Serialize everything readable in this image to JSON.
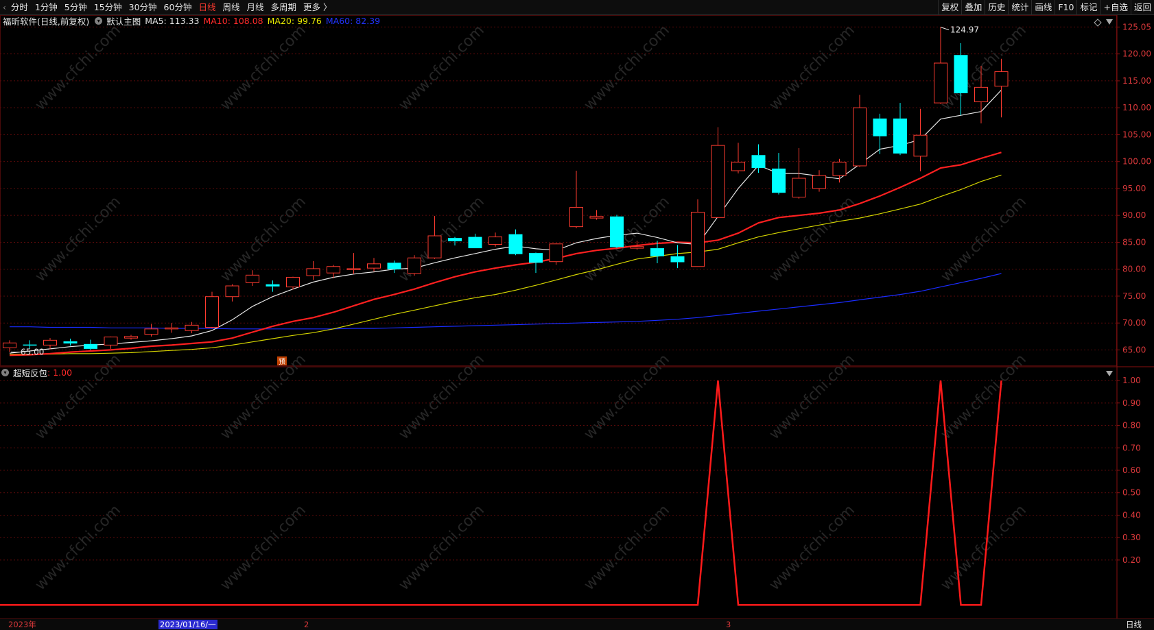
{
  "toolbar": {
    "left_items": [
      {
        "label": "分时",
        "active": false
      },
      {
        "label": "1分钟",
        "active": false
      },
      {
        "label": "5分钟",
        "active": false
      },
      {
        "label": "15分钟",
        "active": false
      },
      {
        "label": "30分钟",
        "active": false
      },
      {
        "label": "60分钟",
        "active": false
      },
      {
        "label": "日线",
        "active": true
      },
      {
        "label": "周线",
        "active": false
      },
      {
        "label": "月线",
        "active": false
      },
      {
        "label": "多周期",
        "active": false
      },
      {
        "label": "更多 〉",
        "active": false
      }
    ],
    "right_items": [
      "复权",
      "叠加",
      "历史",
      "统计",
      "画线",
      "F10",
      "标记",
      "+自选",
      "返回"
    ]
  },
  "main_legend": {
    "stock": "福昕软件(日线,前复权)",
    "main_label": "默认主图",
    "ma5": "MA5: 113.33",
    "ma10": "MA10: 108.08",
    "ma20": "MA20: 99.76",
    "ma60": "MA60: 82.39"
  },
  "sub_legend": {
    "name": "超短反包",
    "value": ": 1.00"
  },
  "colors": {
    "up": "#ff3b30",
    "down": "#00ffff",
    "ma5": "#e6e6e6",
    "ma10": "#ff2020",
    "ma20": "#d4d400",
    "ma60": "#1a2cff",
    "axis": "#d8383a",
    "grid": "#5a0a0a"
  },
  "chart_data": [
    {
      "type": "candlestick",
      "title": "福昕软件(日线,前复权)",
      "yticks": [
        65,
        70,
        75,
        80,
        85,
        90,
        95,
        100,
        105,
        110,
        115,
        120,
        125
      ],
      "ytick_labels": [
        "65.00",
        "70.00",
        "75.00",
        "80.00",
        "85.00",
        "90.00",
        "95.00",
        "100.00",
        "105.00",
        "110.00",
        "115.00",
        "120.00",
        "125.05"
      ],
      "ylim": [
        62.0,
        126.2
      ],
      "annotations": {
        "max_label": "124.97",
        "min_label": "65.00",
        "pre_marker": "预"
      },
      "candles": [
        {
          "o": 65.4,
          "h": 66.8,
          "l": 64.6,
          "c": 66.3
        },
        {
          "o": 66.0,
          "h": 66.8,
          "l": 65.2,
          "c": 65.9
        },
        {
          "o": 65.9,
          "h": 67.2,
          "l": 65.1,
          "c": 66.8
        },
        {
          "o": 66.6,
          "h": 67.1,
          "l": 65.8,
          "c": 66.2
        },
        {
          "o": 66.1,
          "h": 66.9,
          "l": 65.0,
          "c": 65.2
        },
        {
          "o": 65.9,
          "h": 67.5,
          "l": 65.2,
          "c": 67.4
        },
        {
          "o": 67.2,
          "h": 67.8,
          "l": 66.9,
          "c": 67.5
        },
        {
          "o": 67.9,
          "h": 69.8,
          "l": 67.5,
          "c": 68.9
        },
        {
          "o": 68.9,
          "h": 70.0,
          "l": 68.2,
          "c": 69.1
        },
        {
          "o": 68.6,
          "h": 70.2,
          "l": 68.1,
          "c": 69.6
        },
        {
          "o": 69.2,
          "h": 75.8,
          "l": 69.0,
          "c": 74.9
        },
        {
          "o": 74.9,
          "h": 77.2,
          "l": 74.0,
          "c": 76.9
        },
        {
          "o": 77.5,
          "h": 79.8,
          "l": 76.9,
          "c": 78.9
        },
        {
          "o": 77.2,
          "h": 77.9,
          "l": 75.8,
          "c": 76.8
        },
        {
          "o": 76.7,
          "h": 78.6,
          "l": 76.2,
          "c": 78.5
        },
        {
          "o": 78.8,
          "h": 81.5,
          "l": 78.0,
          "c": 80.1
        },
        {
          "o": 79.3,
          "h": 80.8,
          "l": 78.3,
          "c": 80.5
        },
        {
          "o": 80.1,
          "h": 83.0,
          "l": 79.1,
          "c": 80.1
        },
        {
          "o": 80.2,
          "h": 82.1,
          "l": 79.6,
          "c": 81.0
        },
        {
          "o": 81.2,
          "h": 81.6,
          "l": 79.3,
          "c": 80.0
        },
        {
          "o": 79.2,
          "h": 82.6,
          "l": 78.8,
          "c": 82.1
        },
        {
          "o": 82.1,
          "h": 89.9,
          "l": 81.9,
          "c": 86.2
        },
        {
          "o": 85.8,
          "h": 86.0,
          "l": 84.4,
          "c": 85.2
        },
        {
          "o": 86.0,
          "h": 86.6,
          "l": 83.9,
          "c": 83.9
        },
        {
          "o": 84.6,
          "h": 86.8,
          "l": 84.2,
          "c": 86.0
        },
        {
          "o": 86.5,
          "h": 87.4,
          "l": 82.6,
          "c": 82.8
        },
        {
          "o": 83.0,
          "h": 83.1,
          "l": 79.3,
          "c": 81.2
        },
        {
          "o": 81.4,
          "h": 84.8,
          "l": 80.8,
          "c": 84.7
        },
        {
          "o": 87.9,
          "h": 98.3,
          "l": 87.6,
          "c": 91.5
        },
        {
          "o": 89.5,
          "h": 91.0,
          "l": 89.2,
          "c": 89.8
        },
        {
          "o": 89.8,
          "h": 90.1,
          "l": 83.9,
          "c": 84.1
        },
        {
          "o": 83.9,
          "h": 85.3,
          "l": 83.6,
          "c": 84.2
        },
        {
          "o": 83.9,
          "h": 85.3,
          "l": 81.1,
          "c": 82.4
        },
        {
          "o": 82.4,
          "h": 84.5,
          "l": 80.2,
          "c": 81.3
        },
        {
          "o": 80.5,
          "h": 93.0,
          "l": 80.5,
          "c": 90.6
        },
        {
          "o": 89.6,
          "h": 106.4,
          "l": 89.6,
          "c": 103.0
        },
        {
          "o": 98.3,
          "h": 103.5,
          "l": 97.8,
          "c": 99.9
        },
        {
          "o": 101.2,
          "h": 103.2,
          "l": 97.9,
          "c": 98.8
        },
        {
          "o": 98.7,
          "h": 101.6,
          "l": 93.9,
          "c": 94.2
        },
        {
          "o": 93.4,
          "h": 102.5,
          "l": 93.1,
          "c": 96.9
        },
        {
          "o": 95.0,
          "h": 98.4,
          "l": 94.4,
          "c": 97.4
        },
        {
          "o": 97.4,
          "h": 100.5,
          "l": 96.1,
          "c": 99.9
        },
        {
          "o": 99.2,
          "h": 112.4,
          "l": 99.0,
          "c": 110.0
        },
        {
          "o": 108.0,
          "h": 108.9,
          "l": 101.4,
          "c": 104.7
        },
        {
          "o": 108.0,
          "h": 110.9,
          "l": 101.2,
          "c": 101.5
        },
        {
          "o": 101.0,
          "h": 109.8,
          "l": 98.2,
          "c": 104.9
        },
        {
          "o": 110.9,
          "h": 124.97,
          "l": 110.7,
          "c": 118.3
        },
        {
          "o": 119.8,
          "h": 122.0,
          "l": 108.6,
          "c": 112.7
        },
        {
          "o": 111.1,
          "h": 117.8,
          "l": 107.1,
          "c": 113.8
        },
        {
          "o": 114.0,
          "h": 119.1,
          "l": 108.2,
          "c": 116.7
        }
      ],
      "ma5": [
        64.4,
        64.8,
        65.2,
        65.6,
        65.9,
        66.1,
        66.4,
        66.7,
        67.1,
        67.6,
        68.6,
        70.6,
        73.1,
        74.9,
        76.3,
        77.6,
        78.5,
        79.1,
        79.5,
        80.0,
        80.2,
        81.2,
        82.1,
        82.9,
        83.7,
        84.3,
        83.8,
        83.5,
        84.9,
        85.7,
        86.3,
        86.7,
        85.9,
        84.9,
        84.6,
        89.8,
        95.0,
        99.3,
        97.8,
        97.8,
        97.3,
        96.8,
        99.5,
        102.3,
        103.0,
        104.1,
        107.9,
        108.6,
        109.3,
        113.3
      ],
      "ma10": [
        64.0,
        64.1,
        64.3,
        64.6,
        64.8,
        65.0,
        65.3,
        65.7,
        65.9,
        66.2,
        66.5,
        67.2,
        68.3,
        69.4,
        70.3,
        71.0,
        72.0,
        73.2,
        74.4,
        75.3,
        76.3,
        77.5,
        78.6,
        79.5,
        80.2,
        80.8,
        81.3,
        82.0,
        82.9,
        83.5,
        83.9,
        84.4,
        84.8,
        85.0,
        84.9,
        85.4,
        86.7,
        88.6,
        89.6,
        90.0,
        90.4,
        91.0,
        92.2,
        93.6,
        95.2,
        96.9,
        98.8,
        99.4,
        100.6,
        101.7
      ],
      "ma20": [
        64.2,
        64.2,
        64.2,
        64.3,
        64.3,
        64.4,
        64.5,
        64.7,
        64.9,
        65.1,
        65.4,
        65.9,
        66.5,
        67.1,
        67.7,
        68.2,
        68.9,
        69.8,
        70.7,
        71.6,
        72.4,
        73.2,
        74.0,
        74.7,
        75.3,
        76.1,
        77.0,
        78.0,
        79.0,
        79.9,
        80.9,
        81.9,
        82.4,
        82.9,
        83.2,
        83.7,
        84.9,
        86.0,
        86.8,
        87.5,
        88.2,
        88.9,
        89.5,
        90.3,
        91.2,
        92.1,
        93.5,
        94.8,
        96.3,
        97.5
      ],
      "ma60": [
        69.3,
        69.3,
        69.2,
        69.2,
        69.2,
        69.1,
        69.1,
        69.1,
        69.0,
        69.0,
        69.0,
        68.9,
        68.9,
        68.9,
        68.9,
        68.9,
        68.9,
        69.0,
        69.0,
        69.1,
        69.2,
        69.3,
        69.4,
        69.5,
        69.6,
        69.7,
        69.8,
        69.9,
        70.0,
        70.1,
        70.2,
        70.3,
        70.5,
        70.7,
        71.0,
        71.4,
        71.8,
        72.2,
        72.6,
        73.0,
        73.4,
        73.8,
        74.3,
        74.8,
        75.3,
        75.9,
        76.7,
        77.5,
        78.3,
        79.2
      ]
    },
    {
      "type": "line",
      "title": "超短反包",
      "yticks": [
        0.2,
        0.3,
        0.4,
        0.5,
        0.6,
        0.7,
        0.8,
        0.9,
        1.0
      ],
      "ytick_labels": [
        "0.20",
        "0.30",
        "0.40",
        "0.50",
        "0.60",
        "0.70",
        "0.80",
        "0.90",
        "1.00"
      ],
      "ylim": [
        -0.06,
        1.04
      ],
      "series": [
        {
          "values": [
            0,
            0,
            0,
            0,
            0,
            0,
            0,
            0,
            0,
            0,
            0,
            0,
            0,
            0,
            0,
            0,
            0,
            0,
            0,
            0,
            0,
            0,
            0,
            0,
            0,
            0,
            0,
            0,
            0,
            0,
            0,
            0,
            0,
            0,
            0,
            1,
            0,
            0,
            0,
            0,
            0,
            0,
            0,
            0,
            0,
            0,
            1,
            0,
            0,
            1
          ]
        }
      ]
    }
  ],
  "bottom_bar": {
    "year": "2023年",
    "cursor_date": "2023/01/16/一",
    "month1": "2",
    "month2": "3",
    "period": "日线"
  }
}
